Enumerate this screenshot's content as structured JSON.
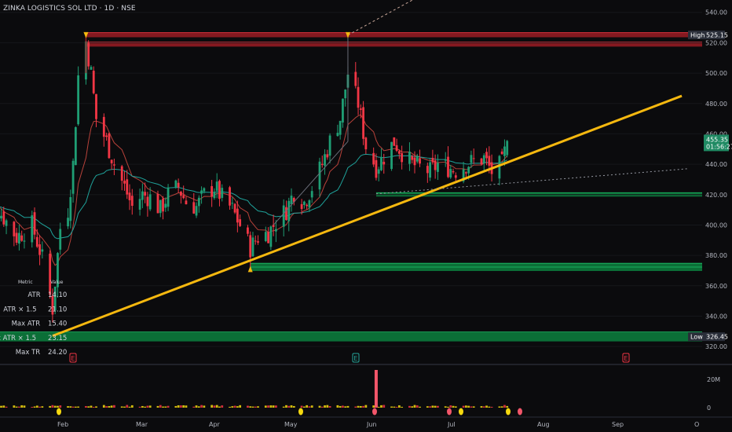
{
  "header": {
    "title": "ZINKA LOGISTICS SOL LTD · 1D · NSE"
  },
  "colors": {
    "bg": "#0b0b0d",
    "up": "#1f9e74",
    "down": "#f23645",
    "trend": "#f5b80f",
    "resistance": "#9b1c24",
    "support": "#0b7a3c",
    "ema_fast": "#b8423a",
    "ema_slow": "#1fa29a",
    "volume_up": "#f5d90f",
    "volume_down": "#f23645"
  },
  "price_tags": {
    "high": {
      "label": "High",
      "value": "525.15"
    },
    "low": {
      "label": "Low",
      "value": "326.45"
    },
    "last": {
      "value": "455.35",
      "countdown": "01:56:27"
    }
  },
  "events": [
    "E",
    "E",
    "E"
  ],
  "stats_table": {
    "headers": [
      "Metric",
      "Value"
    ],
    "rows": [
      [
        "ATR",
        "14.10"
      ],
      [
        "ATR × 1.5",
        "21.10"
      ],
      [
        "Max ATR",
        "15.40"
      ],
      [
        "Max ATR × 1.5",
        "23.15"
      ],
      [
        "Max TR",
        "24.20"
      ]
    ]
  },
  "chart_data": {
    "type": "candlestick",
    "title": "ZINKA LOGISTICS SOL LTD · 1D · NSE",
    "y_axis": {
      "ylim": [
        318,
        544
      ],
      "ticks": [
        320,
        340,
        360,
        380,
        400,
        420,
        440,
        460,
        480,
        500,
        520,
        540
      ]
    },
    "x_axis": {
      "labels": [
        "Feb",
        "Mar",
        "Apr",
        "May",
        "Jun",
        "Jul",
        "Aug",
        "Sep",
        "O"
      ]
    },
    "volume_axis": {
      "ticks": [
        "20M",
        "0"
      ]
    },
    "close_series": [
      [
        "2024-12-30",
        412
      ],
      [
        "2025-01-03",
        418
      ],
      [
        "2025-01-09",
        405
      ],
      [
        "2025-01-14",
        392
      ],
      [
        "2025-01-20",
        400
      ],
      [
        "2025-01-24",
        378
      ],
      [
        "2025-01-28",
        345
      ],
      [
        "2025-01-31",
        398
      ],
      [
        "2025-02-03",
        410
      ],
      [
        "2025-02-05",
        440
      ],
      [
        "2025-02-07",
        498
      ],
      [
        "2025-02-10",
        521
      ],
      [
        "2025-02-12",
        500
      ],
      [
        "2025-02-14",
        470
      ],
      [
        "2025-02-18",
        455
      ],
      [
        "2025-02-21",
        440
      ],
      [
        "2025-02-25",
        425
      ],
      [
        "2025-02-28",
        412
      ],
      [
        "2025-03-04",
        420
      ],
      [
        "2025-03-07",
        418
      ],
      [
        "2025-03-11",
        410
      ],
      [
        "2025-03-14",
        420
      ],
      [
        "2025-03-18",
        425
      ],
      [
        "2025-03-21",
        415
      ],
      [
        "2025-03-25",
        412
      ],
      [
        "2025-03-28",
        420
      ],
      [
        "2025-04-01",
        425
      ],
      [
        "2025-04-04",
        418
      ],
      [
        "2025-04-08",
        410
      ],
      [
        "2025-04-11",
        400
      ],
      [
        "2025-04-15",
        385
      ],
      [
        "2025-04-18",
        392
      ],
      [
        "2025-04-22",
        395
      ],
      [
        "2025-04-25",
        402
      ],
      [
        "2025-04-29",
        410
      ],
      [
        "2025-05-02",
        422
      ],
      [
        "2025-05-06",
        415
      ],
      [
        "2025-05-09",
        425
      ],
      [
        "2025-05-13",
        440
      ],
      [
        "2025-05-16",
        455
      ],
      [
        "2025-05-20",
        470
      ],
      [
        "2025-05-23",
        500
      ],
      [
        "2025-05-27",
        480
      ],
      [
        "2025-05-30",
        452
      ],
      [
        "2025-06-03",
        438
      ],
      [
        "2025-06-06",
        445
      ],
      [
        "2025-06-10",
        455
      ],
      [
        "2025-06-13",
        448
      ],
      [
        "2025-06-17",
        440
      ],
      [
        "2025-06-20",
        438
      ],
      [
        "2025-06-24",
        435
      ],
      [
        "2025-06-27",
        440
      ],
      [
        "2025-07-01",
        438
      ],
      [
        "2025-07-04",
        436
      ],
      [
        "2025-07-08",
        440
      ],
      [
        "2025-07-11",
        442
      ],
      [
        "2025-07-15",
        444
      ],
      [
        "2025-07-18",
        435
      ],
      [
        "2025-07-22",
        440
      ],
      [
        "2025-07-24",
        455.35
      ]
    ],
    "levels": [
      {
        "kind": "resistance",
        "from": "2025-02-10",
        "price": 525.15
      },
      {
        "kind": "resistance",
        "from": "2025-02-10",
        "price": 519
      },
      {
        "kind": "support",
        "from": "2025-06-03",
        "price": 420
      },
      {
        "kind": "support",
        "from": "2025-04-15",
        "price": 373.5
      },
      {
        "kind": "support",
        "from": "2025-04-15",
        "price": 371
      },
      {
        "kind": "support",
        "from": "2024-12-28",
        "price": 326.45
      }
    ],
    "trendline": {
      "from": [
        "2025-01-28",
        327
      ],
      "to": [
        "2025-09-30",
        485
      ]
    },
    "volume_spike": {
      "date": "2025-06-03",
      "value": "20M+"
    }
  }
}
